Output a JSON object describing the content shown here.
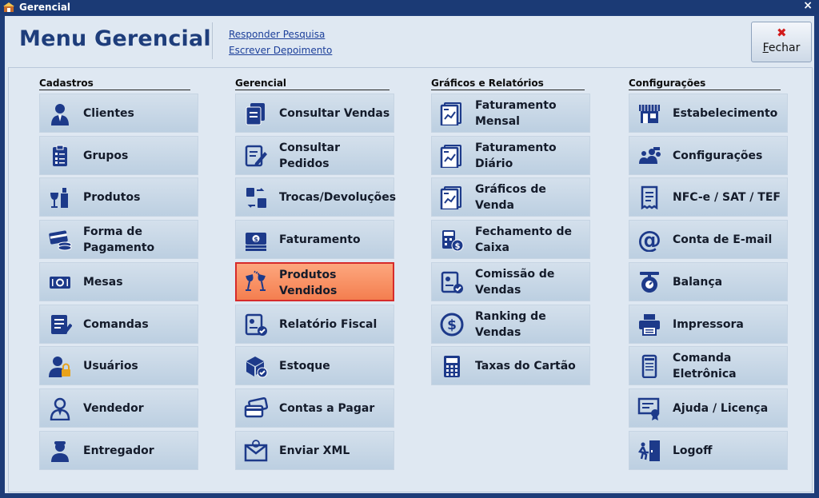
{
  "window": {
    "title": "Gerencial",
    "close_glyph": "×"
  },
  "header": {
    "title": "Menu Gerencial",
    "links": [
      "Responder Pesquisa",
      "Escrever Depoimento"
    ],
    "close_button": {
      "accel": "F",
      "rest": "echar",
      "icon": "red-x-icon"
    }
  },
  "columns": [
    {
      "title": "Cadastros",
      "items": [
        {
          "label": "Clientes",
          "icon": "customer-icon"
        },
        {
          "label": "Grupos",
          "icon": "clipboard-list-icon"
        },
        {
          "label": "Produtos",
          "icon": "bottle-glass-icon"
        },
        {
          "label": "Forma de Pagamento",
          "icon": "card-coins-icon"
        },
        {
          "label": "Mesas",
          "icon": "table-plate-icon"
        },
        {
          "label": "Comandas",
          "icon": "order-list-icon"
        },
        {
          "label": "Usuários",
          "icon": "user-lock-icon"
        },
        {
          "label": "Vendedor",
          "icon": "salesman-icon"
        },
        {
          "label": "Entregador",
          "icon": "delivery-person-icon"
        }
      ]
    },
    {
      "title": "Gerencial",
      "items": [
        {
          "label": "Consultar Vendas",
          "icon": "document-copy-icon"
        },
        {
          "label": "Consultar Pedidos",
          "icon": "document-edit-icon"
        },
        {
          "label": "Trocas/Devoluções",
          "icon": "shopping-bag-exchange-icon"
        },
        {
          "label": "Faturamento",
          "icon": "money-stack-icon"
        },
        {
          "label": "Produtos Vendidos",
          "icon": "wine-toast-icon",
          "selected": true
        },
        {
          "label": "Relatório Fiscal",
          "icon": "report-check-icon"
        },
        {
          "label": "Estoque",
          "icon": "box-check-icon"
        },
        {
          "label": "Contas a Pagar",
          "icon": "payment-cards-icon"
        },
        {
          "label": "Enviar XML",
          "icon": "envelope-at-icon"
        }
      ]
    },
    {
      "title": "Gráficos e Relatórios",
      "items": [
        {
          "label": "Faturamento Mensal",
          "icon": "chart-document-icon"
        },
        {
          "label": "Faturamento Diário",
          "icon": "chart-document-icon"
        },
        {
          "label": "Gráficos de Venda",
          "icon": "chart-document-icon"
        },
        {
          "label": "Fechamento de Caixa",
          "icon": "calculator-coin-icon"
        },
        {
          "label": "Comissão de Vendas",
          "icon": "report-user-icon"
        },
        {
          "label": "Ranking de Vendas",
          "icon": "dollar-circle-icon"
        },
        {
          "label": "Taxas do Cartão",
          "icon": "calculator-icon"
        }
      ]
    },
    {
      "title": "Configurações",
      "items": [
        {
          "label": "Estabelecimento",
          "icon": "storefront-icon"
        },
        {
          "label": "Configurações",
          "icon": "people-settings-icon"
        },
        {
          "label": "NFC-e / SAT / TEF",
          "icon": "receipt-icon"
        },
        {
          "label": "Conta de E-mail",
          "icon": "at-sign-icon"
        },
        {
          "label": "Balança",
          "icon": "scale-icon"
        },
        {
          "label": "Impressora",
          "icon": "printer-icon"
        },
        {
          "label": "Comanda Eletrônica",
          "icon": "mobile-device-icon"
        },
        {
          "label": "Ajuda / Licença",
          "icon": "certificate-icon"
        },
        {
          "label": "Logoff",
          "icon": "exit-door-icon"
        }
      ]
    }
  ]
}
